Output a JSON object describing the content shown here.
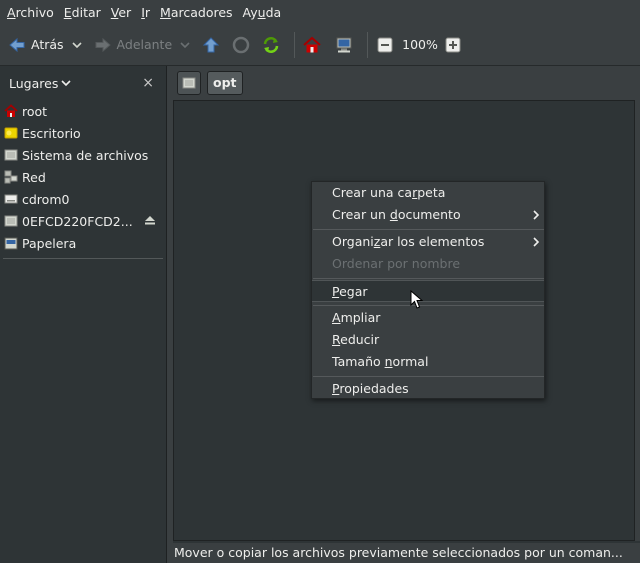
{
  "menubar": {
    "items": [
      {
        "pre": "",
        "u": "A",
        "post": "rchivo"
      },
      {
        "pre": "",
        "u": "E",
        "post": "ditar"
      },
      {
        "pre": "",
        "u": "V",
        "post": "er"
      },
      {
        "pre": "",
        "u": "I",
        "post": "r"
      },
      {
        "pre": "",
        "u": "M",
        "post": "arcadores"
      },
      {
        "pre": "Ay",
        "u": "u",
        "post": "da"
      }
    ]
  },
  "toolbar": {
    "back_label": "Atrás",
    "forward_label": "Adelante",
    "zoom_label": "100%"
  },
  "sidebar": {
    "title": "Lugares",
    "close_glyph": "×",
    "items": [
      {
        "label": "root",
        "icon": "home-icon"
      },
      {
        "label": "Escritorio",
        "icon": "desktop-icon"
      },
      {
        "label": "Sistema de archivos",
        "icon": "drive-icon"
      },
      {
        "label": "Red",
        "icon": "network-icon"
      },
      {
        "label": "cdrom0",
        "icon": "cdrom-icon"
      },
      {
        "label": "0EFCD220FCD2...",
        "icon": "drive-icon"
      },
      {
        "label": "Papelera",
        "icon": "trash-icon"
      }
    ]
  },
  "location": {
    "current": "opt"
  },
  "statusbar": {
    "text": "Mover o copiar los archivos previamente seleccionados por un coman..."
  },
  "context_menu": {
    "items": [
      {
        "pre": "Crear una ca",
        "u": "r",
        "post": "peta",
        "disabled": false,
        "submenu": false
      },
      {
        "pre": "Crear un ",
        "u": "d",
        "post": "ocumento",
        "disabled": false,
        "submenu": true
      },
      {
        "pre": "Organi",
        "u": "z",
        "post": "ar los elementos",
        "disabled": false,
        "submenu": true
      },
      {
        "pre": "Ordenar por nombre",
        "u": "",
        "post": "",
        "disabled": true,
        "submenu": false
      },
      {
        "pre": "",
        "u": "P",
        "post": "egar",
        "disabled": false,
        "submenu": false
      },
      {
        "pre": "",
        "u": "A",
        "post": "mpliar",
        "disabled": false,
        "submenu": false
      },
      {
        "pre": "",
        "u": "R",
        "post": "educir",
        "disabled": false,
        "submenu": false
      },
      {
        "pre": "Tamaño ",
        "u": "n",
        "post": "ormal",
        "disabled": false,
        "submenu": false
      },
      {
        "pre": "",
        "u": "P",
        "post": "ropiedades",
        "disabled": false,
        "submenu": false
      }
    ]
  },
  "colors": {
    "background": "#2e3436",
    "panel": "#3a3f41",
    "text": "#eeeeec",
    "accent_blue": "#3465a4",
    "accent_green": "#4e9a06",
    "accent_red": "#cc0000"
  }
}
